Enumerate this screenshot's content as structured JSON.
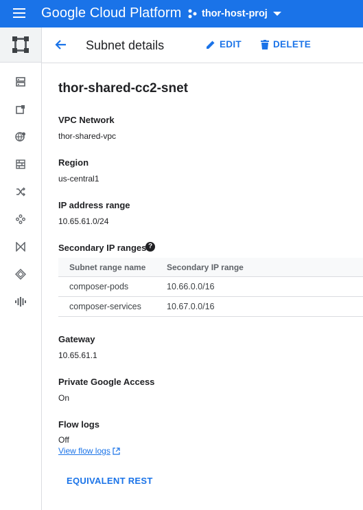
{
  "topbar": {
    "brand": "Google Cloud Platform",
    "project": "thor-host-proj"
  },
  "rail": {
    "icons": [
      "compute-engine-icon",
      "instance-template-icon",
      "vpc-network-icon",
      "firewall-icon",
      "routes-icon",
      "hub-icon",
      "interconnect-icon",
      "network-services-icon",
      "network-intelligence-icon"
    ]
  },
  "header": {
    "title": "Subnet details",
    "edit_label": "EDIT",
    "delete_label": "DELETE"
  },
  "subnet": {
    "name": "thor-shared-cc2-snet",
    "vpc_label": "VPC Network",
    "vpc_value": "thor-shared-vpc",
    "region_label": "Region",
    "region_value": "us-central1",
    "ip_label": "IP address range",
    "ip_value": "10.65.61.0/24",
    "secondary_label": "Secondary IP ranges",
    "help_glyph": "?",
    "secondary_table": {
      "headers": [
        "Subnet range name",
        "Secondary IP range"
      ],
      "rows": [
        [
          "composer-pods",
          "10.66.0.0/16"
        ],
        [
          "composer-services",
          "10.67.0.0/16"
        ]
      ]
    },
    "gateway_label": "Gateway",
    "gateway_value": "10.65.61.1",
    "pga_label": "Private Google Access",
    "pga_value": "On",
    "flow_label": "Flow logs",
    "flow_value": "Off",
    "flow_link": "View flow logs",
    "rest_label": "EQUIVALENT REST"
  },
  "colors": {
    "brand_blue": "#1a73e8",
    "text": "#202124",
    "divider": "#dadce0"
  }
}
